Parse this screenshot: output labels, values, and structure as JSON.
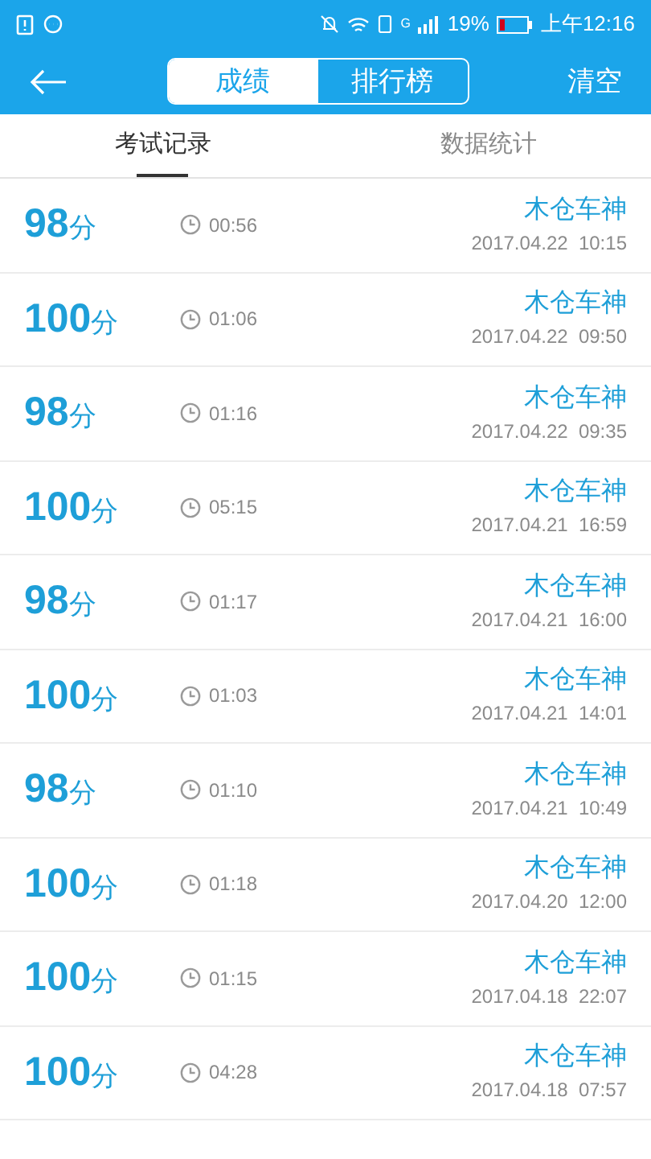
{
  "status_bar": {
    "battery": "19%",
    "time": "上午12:16",
    "network": "G"
  },
  "header": {
    "segments": [
      {
        "label": "成绩",
        "selected": true
      },
      {
        "label": "排行榜",
        "selected": false
      }
    ],
    "action": "清空"
  },
  "tabs": [
    {
      "label": "考试记录",
      "selected": true
    },
    {
      "label": "数据统计",
      "selected": false
    }
  ],
  "records": [
    {
      "score": "98",
      "unit": "分",
      "duration": "00:56",
      "name": "木仓车神",
      "date": "2017.04.22  10:15"
    },
    {
      "score": "100",
      "unit": "分",
      "duration": "01:06",
      "name": "木仓车神",
      "date": "2017.04.22  09:50"
    },
    {
      "score": "98",
      "unit": "分",
      "duration": "01:16",
      "name": "木仓车神",
      "date": "2017.04.22  09:35"
    },
    {
      "score": "100",
      "unit": "分",
      "duration": "05:15",
      "name": "木仓车神",
      "date": "2017.04.21  16:59"
    },
    {
      "score": "98",
      "unit": "分",
      "duration": "01:17",
      "name": "木仓车神",
      "date": "2017.04.21  16:00"
    },
    {
      "score": "100",
      "unit": "分",
      "duration": "01:03",
      "name": "木仓车神",
      "date": "2017.04.21  14:01"
    },
    {
      "score": "98",
      "unit": "分",
      "duration": "01:10",
      "name": "木仓车神",
      "date": "2017.04.21  10:49"
    },
    {
      "score": "100",
      "unit": "分",
      "duration": "01:18",
      "name": "木仓车神",
      "date": "2017.04.20  12:00"
    },
    {
      "score": "100",
      "unit": "分",
      "duration": "01:15",
      "name": "木仓车神",
      "date": "2017.04.18  22:07"
    },
    {
      "score": "100",
      "unit": "分",
      "duration": "04:28",
      "name": "木仓车神",
      "date": "2017.04.18  07:57"
    }
  ]
}
